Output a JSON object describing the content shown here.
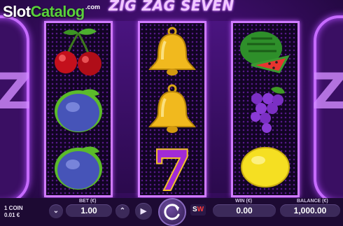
{
  "watermark": {
    "brand_part1": "Slot",
    "brand_part2": "Catalog",
    "suffix": ".com"
  },
  "game": {
    "title": "ZIG ZAG SEVEN"
  },
  "reels": [
    [
      "cherries",
      "plum",
      "plum"
    ],
    [
      "bell",
      "bell",
      "seven"
    ],
    [
      "watermelon",
      "grapes",
      "lemon"
    ]
  ],
  "symbols": {
    "seven_text": "7"
  },
  "controls": {
    "coin_line1": "1 COIN",
    "coin_line2": "0.01 €",
    "bet_label": "BET (€)",
    "bet_value": "1.00",
    "win_label": "WIN (€)",
    "win_value": "0.00",
    "balance_label": "BALANCE (€)",
    "balance_value": "1,000.00",
    "decrease_icon": "chevron-down-icon",
    "increase_icon": "chevron-up-icon",
    "autoplay_icon": "autoplay-icon",
    "spin_icon": "spin-refresh-icon",
    "turbo_label_left": "S",
    "turbo_label_right": "W"
  },
  "colors": {
    "accent_purple": "#d07aff",
    "brand_green": "#5ad03c",
    "panel": "#3c2a5a"
  }
}
